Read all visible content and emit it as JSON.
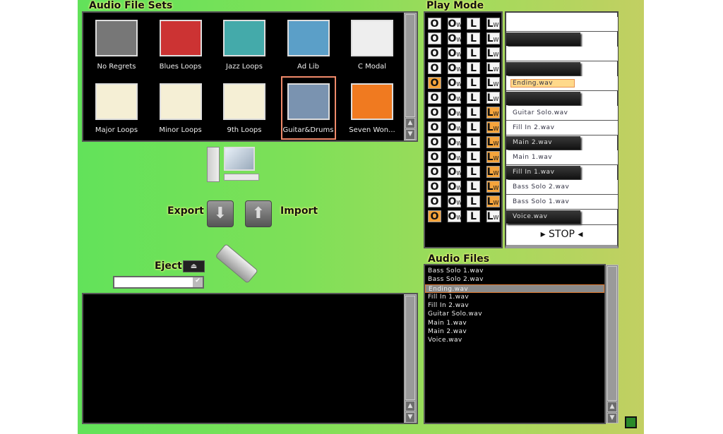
{
  "audio_file_sets": {
    "title": "Audio File Sets",
    "items": [
      {
        "label": "No Regrets",
        "color": "#777"
      },
      {
        "label": "Blues Loops",
        "color": "#c33"
      },
      {
        "label": "Jazz Loops",
        "color": "#4aa"
      },
      {
        "label": "Ad Lib",
        "color": "#5b9fc8"
      },
      {
        "label": "C Modal",
        "color": "#eee"
      },
      {
        "label": "Major Loops",
        "color": "#f5efd5"
      },
      {
        "label": "Minor Loops",
        "color": "#f5efd5"
      },
      {
        "label": "9th Loops",
        "color": "#f5efd5"
      },
      {
        "label": "Guitar&Drums",
        "color": "#7a93b0"
      },
      {
        "label": "Seven Won...",
        "color": "#f07a20"
      }
    ],
    "selected": "Guitar&Drums"
  },
  "transfer": {
    "export_label": "Export",
    "import_label": "Import",
    "eject_label": "Eject",
    "drive_value": "",
    "export_icon": "arrow-down",
    "import_icon": "arrow-up"
  },
  "play_mode": {
    "title": "Play Mode",
    "columns": [
      "O",
      "OW",
      "L",
      "LW"
    ],
    "o_active": [
      4,
      13
    ],
    "lw_active": [
      6,
      7,
      8,
      9,
      10,
      11,
      12
    ],
    "keys": [
      {
        "type": "white",
        "label": ""
      },
      {
        "type": "black",
        "label": ""
      },
      {
        "type": "white",
        "label": ""
      },
      {
        "type": "black",
        "label": ""
      },
      {
        "type": "white",
        "label": "Ending.wav",
        "selected": true
      },
      {
        "type": "black",
        "label": ""
      },
      {
        "type": "white",
        "label": "Guitar Solo.wav"
      },
      {
        "type": "white",
        "label": "Fill In 2.wav"
      },
      {
        "type": "black",
        "label": "Main 2.wav"
      },
      {
        "type": "white",
        "label": "Main 1.wav"
      },
      {
        "type": "black",
        "label": "Fill In 1.wav"
      },
      {
        "type": "white",
        "label": "Bass Solo 2.wav"
      },
      {
        "type": "white",
        "label": "Bass Solo 1.wav"
      },
      {
        "type": "black",
        "label": "Voice.wav"
      }
    ],
    "stop_label": "STOP"
  },
  "audio_files": {
    "title": "Audio Files",
    "items": [
      "Bass Solo 1.wav",
      "Bass Solo 2.wav",
      "Ending.wav",
      "Fill In 1.wav",
      "Fill In 2.wav",
      "Guitar Solo.wav",
      "Main 1.wav",
      "Main 2.wav",
      "Voice.wav"
    ],
    "selected": "Ending.wav"
  },
  "colors": {
    "accent": "#f5a43c",
    "selection_border": "#f08a6a"
  }
}
